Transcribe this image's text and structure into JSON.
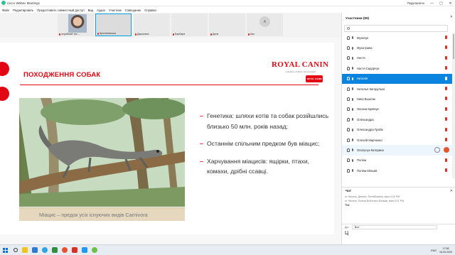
{
  "window": {
    "title": "Cisco Webex Meetings",
    "status": "Подключено",
    "minimize_glyph": "—",
    "maximize_glyph": "▢",
    "close_glyph": "✕"
  },
  "menu": [
    "Файл",
    "Редактировать",
    "Предоставить совместный доступ",
    "Вид",
    "Аудио",
    "Участник",
    "Совещание",
    "Справка"
  ],
  "video_tiles": [
    {
      "name": "серийный тих ... "
    },
    {
      "name": "Крістіанівська"
    },
    {
      "name": "Дашкевич"
    },
    {
      "name": "Барбара"
    },
    {
      "name": "Дина"
    },
    {
      "name": "Аяс",
      "initial": "А"
    }
  ],
  "slide": {
    "title": "ПОХОДЖЕННЯ СОБАК",
    "brand_name": "ROYAL CANIN",
    "brand_sub": "a division of Mars, Incorporated",
    "brand_logo_text": "ROYAL CANIN",
    "caption": "Міацис – предок усіх існуючих видів Carnivora",
    "bullets": [
      "Генетика: шляхи котів та собак розійшлись близько 50 млн. років назад;",
      "Останнім спільним предком був міацис;",
      "Харчування міацисів: ящірки, птахи, комахи, дрібні ссавці."
    ],
    "plus": "+"
  },
  "panel": {
    "title": "Участники (89)",
    "close": "✕",
    "participants": [
      {
        "name": "Музичук",
        "state": "normal"
      },
      {
        "name": "Муха Ірина",
        "state": "normal"
      },
      {
        "name": "Настя",
        "state": "normal"
      },
      {
        "name": "Настя Сидорчук",
        "state": "normal"
      },
      {
        "name": "Наталія",
        "state": "selected"
      },
      {
        "name": "Наталья Загорулько",
        "state": "normal"
      },
      {
        "name": "Ника Выштак",
        "state": "normal"
      },
      {
        "name": "Оксана Кравчук",
        "state": "normal"
      },
      {
        "name": "Олександра",
        "state": "normal"
      },
      {
        "name": "Олександра Грабік",
        "state": "normal"
      },
      {
        "name": "Олексій Марченко",
        "state": "normal"
      },
      {
        "name": "Ополучук Катерина",
        "state": "hover"
      },
      {
        "name": "Поліна",
        "state": "normal"
      },
      {
        "name": "Поліна Мільків",
        "state": "normal"
      }
    ]
  },
  "chat": {
    "title": "Чат",
    "close": "✕",
    "messages": [
      {
        "meta": "от Наталь, Данило Тягнибоківна, всім   9:16 PM",
        "body": ""
      },
      {
        "meta": "от Наталь, Поліна Войтенко-Мільків, всім   9:21 PM",
        "body": "Так"
      }
    ],
    "to_label": "До:",
    "to_value": "Все",
    "input_value": "Ц"
  },
  "taskbar": {
    "lang": "ENG",
    "time": "17:58",
    "date": "16.09.2020"
  },
  "colors": {
    "accent_red": "#e30613",
    "select_blue": "#0b84e0"
  }
}
